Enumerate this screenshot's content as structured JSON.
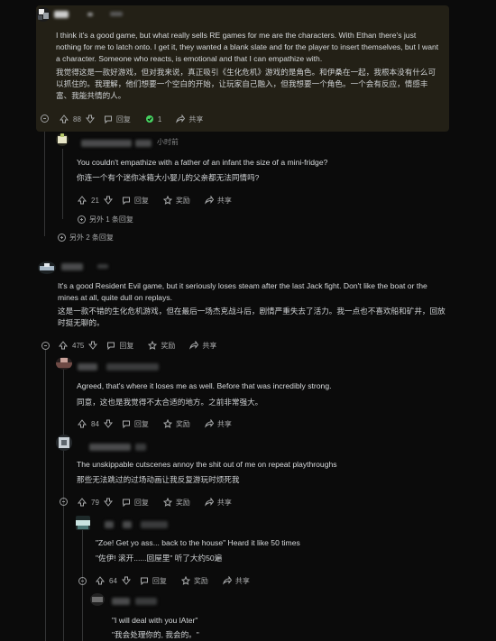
{
  "comments": [
    {
      "id": "c1",
      "time": "",
      "en": "I think it's a good game, but what really sells RE games for me are the characters. With Ethan there's just nothing for me to latch onto. I get it, they wanted a blank slate and for the player to insert themselves, but I want a character. Someone who reacts, is emotional and that I can empathize with.",
      "cn": "我觉得这是一款好游戏，但对我来说，真正吸引《生化危机》游戏的是角色。和伊桑在一起，我根本没有什么可以抓住的。我理解，他们想要一个空白的开始，让玩家自己融入，但我想要一个角色。一个会有反应，情感丰富、我能共情的人。",
      "votes": "88",
      "reply": "回复",
      "award_count": "1",
      "share": "共享"
    },
    {
      "id": "c2",
      "time": "小时前",
      "en": "You couldn't empathize with a father of an infant the size of a mini-fridge?",
      "cn": "你连一个有个迷你冰箱大小婴儿的父亲都无法同情吗?",
      "votes": "21",
      "reply": "回复",
      "award": "奖励",
      "share": "共享",
      "more_replies": "另外 1 条回复"
    },
    {
      "more_replies": "另外 2 条回复"
    },
    {
      "id": "c3",
      "time": "小时前",
      "en": "It's a good Resident Evil game, but it seriously loses steam after the last Jack fight. Don't like the boat or the mines at all, quite dull on replays.",
      "cn": "这是一款不错的生化危机游戏，但在最后一场杰克战斗后，剧情严重失去了活力。我一点也不喜欢船和矿井，回放时挺无聊的。",
      "votes": "475",
      "reply": "回复",
      "award": "奖励",
      "share": "共享"
    },
    {
      "id": "c4",
      "en": "Agreed, that's where it loses me as well. Before that was incredibly strong.",
      "cn": "同意，这也是我觉得不太合适的地方。之前非常强大。",
      "votes": "84",
      "reply": "回复",
      "award": "奖励",
      "share": "共享"
    },
    {
      "id": "c5",
      "en": "The unskippable cutscenes annoy the shit out of me on repeat playthroughs",
      "cn": "那些无法跳过的过场动画让我反复游玩时烦死我",
      "votes": "79",
      "reply": "回复",
      "award": "奖励",
      "share": "共享"
    },
    {
      "id": "c6",
      "en": "\"Zoe! Get yo ass... back to the house\" Heard it like 50 times",
      "cn": "\"佐伊! 滚开......回屋里\" 听了大约50遍",
      "votes": "64",
      "reply": "回复",
      "award": "奖励",
      "share": "共享"
    },
    {
      "id": "c7",
      "en": "\"I will deal with you lAter\"",
      "cn": "\"我会处理你的, 我会的。\""
    }
  ],
  "colors": {
    "background": "#0b0b0b",
    "highlight": "#232016",
    "text": "#d7dadc",
    "muted": "#818384",
    "award_green": "#46d160"
  }
}
